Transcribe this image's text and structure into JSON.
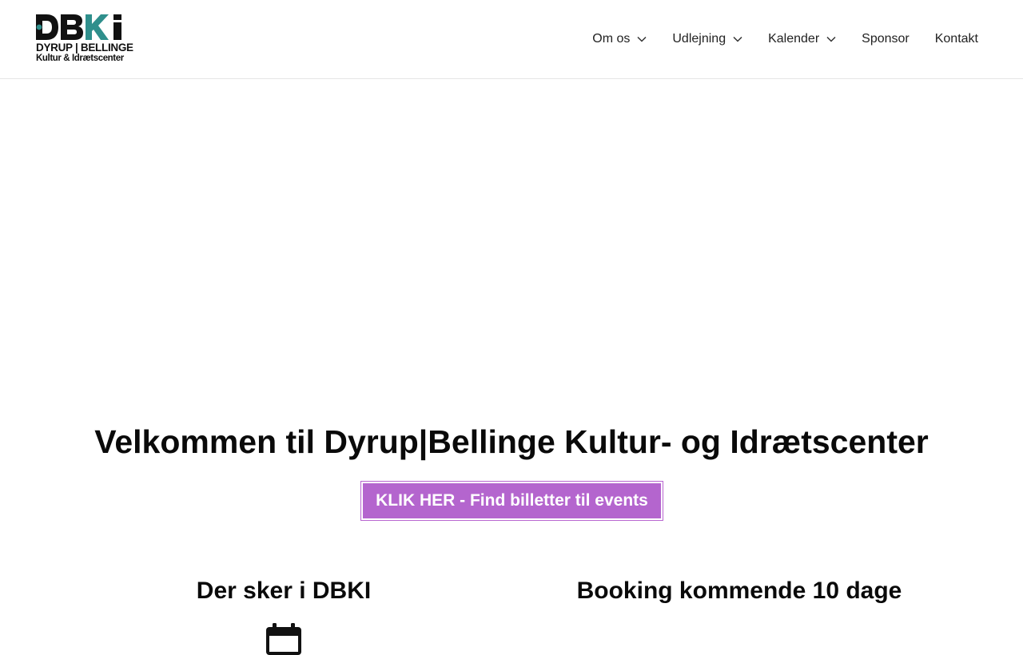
{
  "brand": {
    "logo_mark": "DBKI",
    "logo_line1": "DYRUP | BELLINGE",
    "logo_line2": "Kultur & Idrætscenter",
    "colors": {
      "teal": "#2f8f8c",
      "dark": "#111111"
    }
  },
  "nav": {
    "items": [
      {
        "label": "Om os",
        "has_dropdown": true
      },
      {
        "label": "Udlejning",
        "has_dropdown": true
      },
      {
        "label": "Kalender",
        "has_dropdown": true
      },
      {
        "label": "Sponsor",
        "has_dropdown": false
      },
      {
        "label": "Kontakt",
        "has_dropdown": false
      }
    ]
  },
  "hero": {
    "title": "Velkommen til Dyrup|Bellinge Kultur- og Idrætscenter"
  },
  "cta": {
    "label": "KLIK HER - Find billetter til events",
    "color": "#b465ce"
  },
  "sections": {
    "left_title": "Der sker i DBKI",
    "left_icon": "calendar-icon",
    "right_title": "Booking kommende 10 dage"
  }
}
